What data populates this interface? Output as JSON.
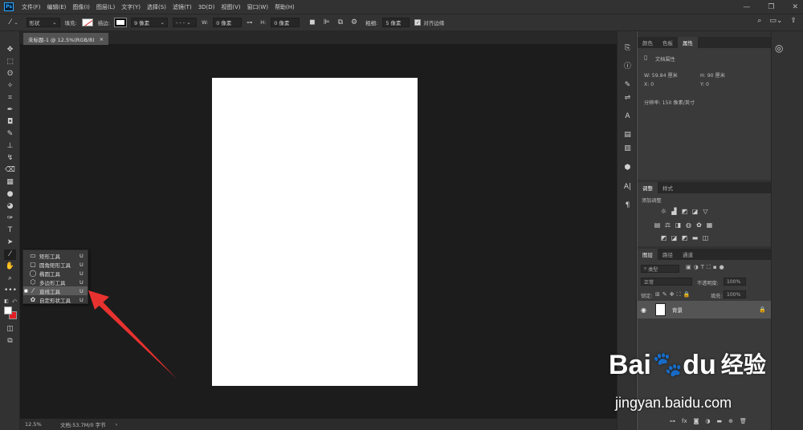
{
  "app": {
    "logo_text": "Ps"
  },
  "menu": [
    "文件(F)",
    "编辑(E)",
    "图像(I)",
    "图层(L)",
    "文字(Y)",
    "选择(S)",
    "滤镜(T)",
    "3D(D)",
    "视图(V)",
    "窗口(W)",
    "帮助(H)"
  ],
  "options": {
    "mode": "形状",
    "fill_label": "填充:",
    "stroke_label": "描边:",
    "stroke_width": "9 像素",
    "w_label": "W:",
    "w_value": "0 像素",
    "h_label": "H:",
    "h_value": "0 像素",
    "weight_label": "粗细:",
    "weight_value": "5 像素",
    "align_edges_label": "对齐边缘"
  },
  "document": {
    "tab_title": "未标题-1 @ 12.5%(RGB/8)",
    "tab_close": "×",
    "zoom": "12.5%",
    "doc_info": "文档:53.7M/0 字节"
  },
  "flyout": {
    "items": [
      {
        "label": "矩形工具",
        "shortcut": "U",
        "selected": false,
        "icon": "rectangle-icon"
      },
      {
        "label": "圆角矩形工具",
        "shortcut": "U",
        "selected": false,
        "icon": "rounded-rectangle-icon"
      },
      {
        "label": "椭圆工具",
        "shortcut": "U",
        "selected": false,
        "icon": "ellipse-icon"
      },
      {
        "label": "多边形工具",
        "shortcut": "U",
        "selected": false,
        "icon": "polygon-icon"
      },
      {
        "label": "直线工具",
        "shortcut": "U",
        "selected": true,
        "icon": "line-icon"
      },
      {
        "label": "自定形状工具",
        "shortcut": "U",
        "selected": false,
        "icon": "custom-shape-icon"
      }
    ]
  },
  "panels": {
    "top_tabs": [
      "颜色",
      "色板",
      "属性"
    ],
    "properties": {
      "title": "文档属性",
      "w": "W:  59.84 厘米",
      "h": "H:  90 厘米",
      "x": "X:  0",
      "y": "Y:  0",
      "resolution": "分辨率: 150 像素/英寸"
    },
    "adjust_tabs": [
      "调整",
      "样式"
    ],
    "adjust_title": "添加调整",
    "layers_tabs": [
      "图层",
      "路径",
      "通道"
    ],
    "layers": {
      "filter_kind": "类型",
      "blend_mode": "正常",
      "opacity_label": "不透明度:",
      "opacity_value": "100%",
      "lock_label": "锁定:",
      "fill_label": "填充:",
      "fill_value": "100%",
      "layer_name": "背景"
    }
  },
  "watermark": {
    "brand_latin": "Bai",
    "brand_latin2": "du",
    "brand_cn": "经验",
    "url": "jingyan.baidu.com"
  },
  "colors": {
    "foreground": "#ffffff",
    "background": "#e01e25",
    "arrow": "#e8322f",
    "accent": "#31a8ff"
  }
}
